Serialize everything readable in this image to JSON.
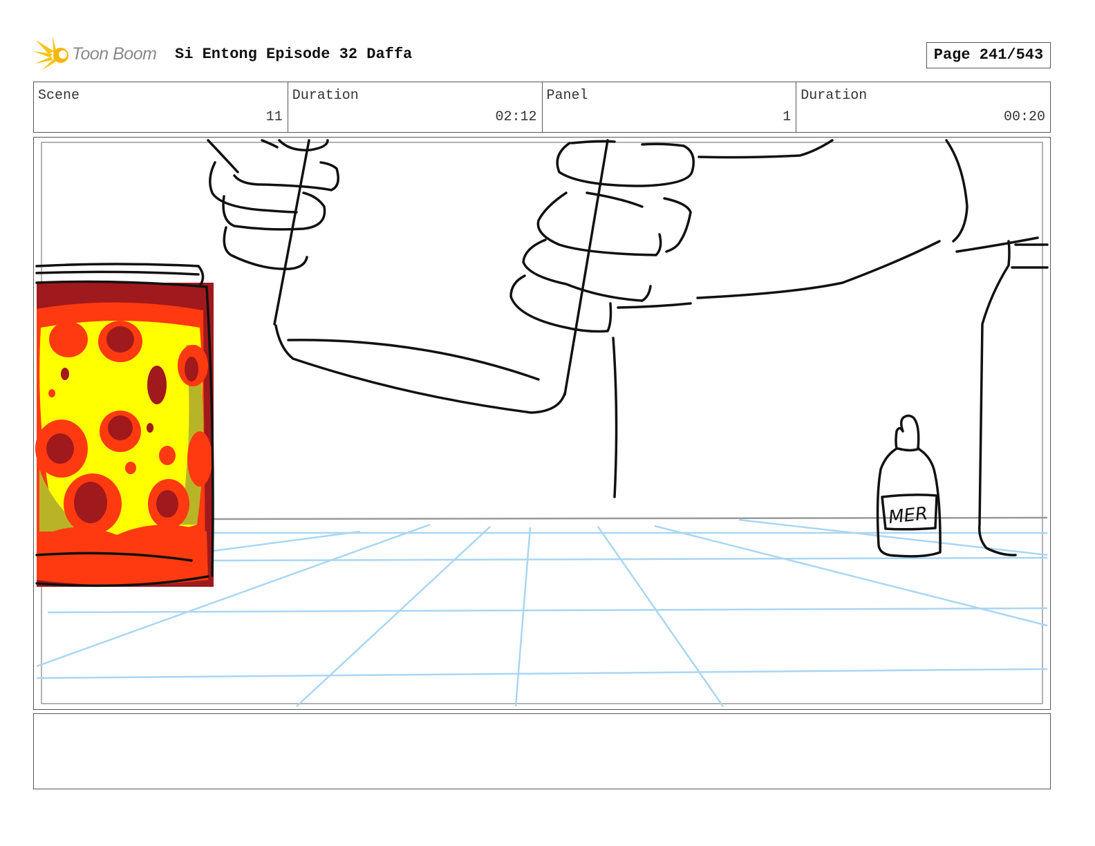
{
  "header": {
    "logo_text": "Toon Boom",
    "title": "Si Entong Episode 32 Daffa",
    "page": "Page 241/543"
  },
  "info": {
    "scene_label": "Scene",
    "scene_value": "11",
    "scene_duration_label": "Duration",
    "scene_duration_value": "02:12",
    "panel_label": "Panel",
    "panel_value": "1",
    "panel_duration_label": "Duration",
    "panel_duration_value": "00:20"
  },
  "panel": {
    "bottle_label": "MER"
  },
  "notes": {
    "text": ""
  },
  "colors": {
    "grid": "#a9d6f2",
    "jar_dark": "#a0191c",
    "jar_red": "#ff3a10",
    "jar_yellow": "#ffff00",
    "jar_olive": "#b8b428",
    "logo_star": "#f5c518",
    "ink": "#111111"
  },
  "icons": {
    "logo": "toon-boom-star-icon"
  }
}
